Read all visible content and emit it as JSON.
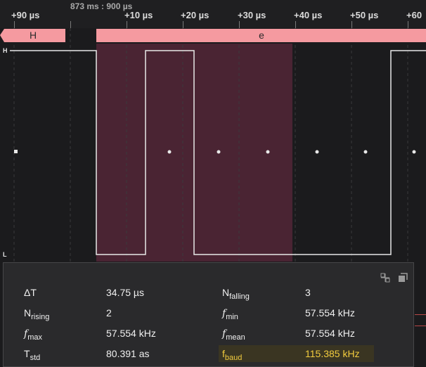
{
  "ruler": {
    "time_ref": "873 ms : 900 µs",
    "ticks": [
      "+90 µs",
      "+10 µs",
      "+20 µs",
      "+30 µs",
      "+40 µs",
      "+50 µs",
      "+60"
    ]
  },
  "channel": {
    "level_high": "H",
    "level_low": "L",
    "segments": [
      "H",
      "e"
    ]
  },
  "colors": {
    "segment_fill": "#f59aa0",
    "highlight_region": "#4a2433",
    "waveform": "#e8e8e8",
    "baud_accent": "#f2cc3e"
  },
  "panel": {
    "icons": [
      "split-view-icon",
      "popout-icon"
    ],
    "rows": [
      {
        "key": "ΔT",
        "sub": "",
        "value": "34.75 µs"
      },
      {
        "key": "N",
        "sub": "falling",
        "value": "3"
      },
      {
        "key": "N",
        "sub": "rising",
        "value": "2"
      },
      {
        "key": "f",
        "sub": "min",
        "value": "57.554 kHz"
      },
      {
        "key": "f",
        "sub": "max",
        "value": "57.554 kHz"
      },
      {
        "key": "f",
        "sub": "mean",
        "value": "57.554 kHz"
      },
      {
        "key": "T",
        "sub": "std",
        "value": "80.391 as"
      },
      {
        "key": "f",
        "sub": "baud",
        "value": "115.385 kHz"
      }
    ]
  }
}
